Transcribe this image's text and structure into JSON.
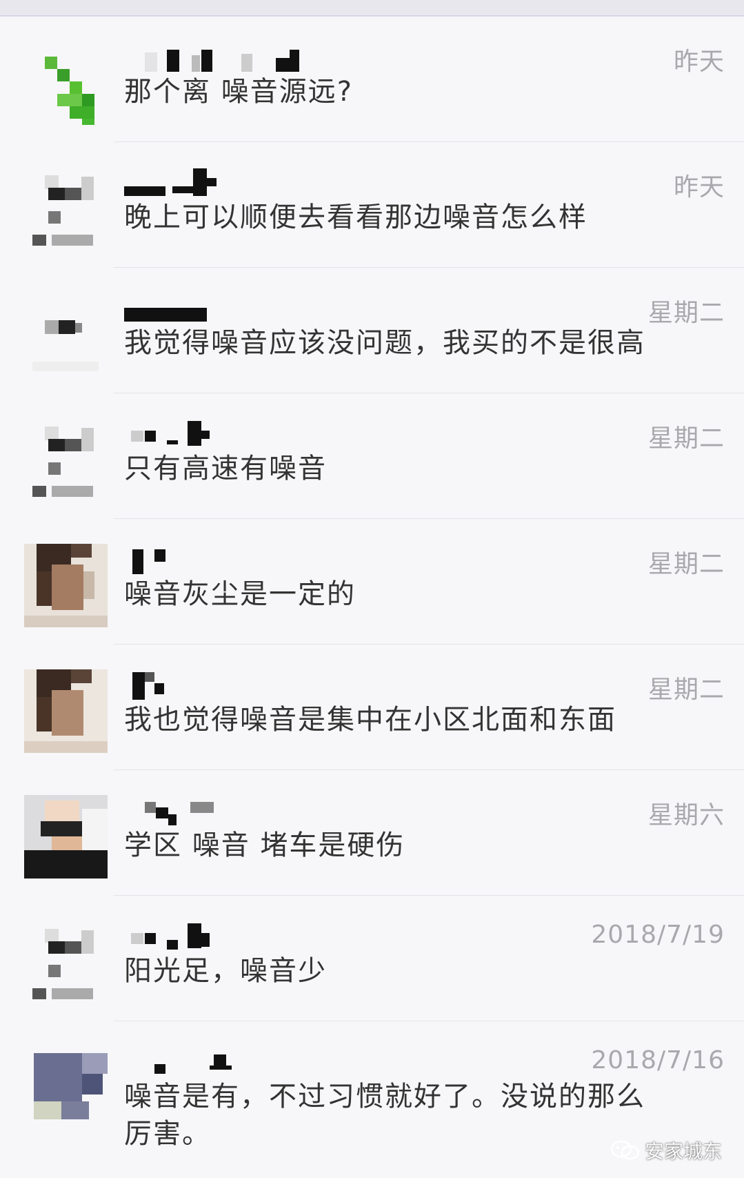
{
  "chats": [
    {
      "time": "昨天",
      "message": "那个离 噪音源远?"
    },
    {
      "time": "昨天",
      "message": "晚上可以顺便去看看那边噪音怎么样"
    },
    {
      "time": "星期二",
      "message": "我觉得噪音应该没问题，我买的不是很高"
    },
    {
      "time": "星期二",
      "message": "只有高速有噪音"
    },
    {
      "time": "星期二",
      "message": "噪音灰尘是一定的"
    },
    {
      "time": "星期二",
      "message": "我也觉得噪音是集中在小区北面和东面"
    },
    {
      "time": "星期六",
      "message": "学区 噪音 堵车是硬伤"
    },
    {
      "time": "2018/7/19",
      "message": "阳光足，噪音少"
    },
    {
      "time": "2018/7/16",
      "message": "噪音是有，不过习惯就好了。没说的那么厉害。"
    }
  ],
  "watermark": {
    "text": "安家城东"
  }
}
